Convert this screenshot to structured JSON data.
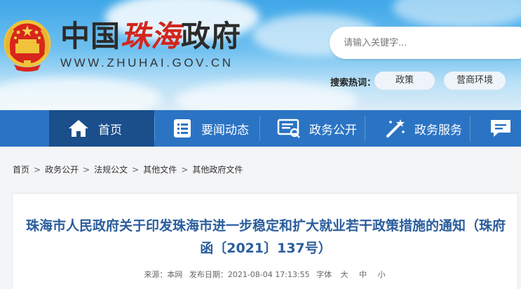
{
  "header": {
    "logo_cn_part1": "中国",
    "logo_cn_part2": "珠海",
    "logo_cn_part3": "政府",
    "logo_en": "WWW.ZHUHAI.GOV.CN",
    "search_placeholder": "请输入关键字...",
    "hot_label": "搜索热词：",
    "hot_tags": [
      "政策",
      "营商环境"
    ]
  },
  "nav": {
    "items": [
      {
        "label": "首页",
        "icon": "home-icon"
      },
      {
        "label": "要闻动态",
        "icon": "news-list-icon"
      },
      {
        "label": "政务公开",
        "icon": "document-list-icon"
      },
      {
        "label": "政务服务",
        "icon": "magic-wand-icon"
      },
      {
        "label": "",
        "icon": "chat-bubble-icon"
      }
    ],
    "active_color": "#1a4f8c",
    "bar_color": "#2b74c4"
  },
  "breadcrumb": [
    "首页",
    "政务公开",
    "法规公文",
    "其他文件",
    "其他政府文件"
  ],
  "article": {
    "title": "珠海市人民政府关于印发珠海市进一步稳定和扩大就业若干政策措施的通知（珠府函〔2021〕137号）",
    "source_label": "来源：本网",
    "date_label": "发布日期：2021-08-04 17:13:55",
    "font_label": "字体",
    "size_large": "大",
    "size_medium": "中",
    "size_small": "小"
  }
}
